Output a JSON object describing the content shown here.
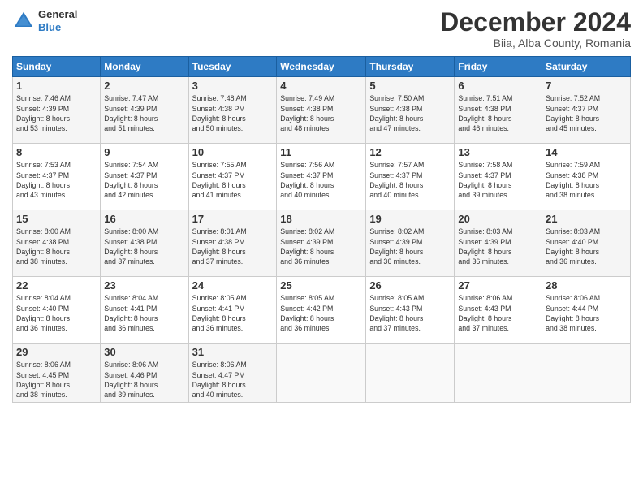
{
  "header": {
    "logo_general": "General",
    "logo_blue": "Blue",
    "title": "December 2024",
    "location": "Biia, Alba County, Romania"
  },
  "weekdays": [
    "Sunday",
    "Monday",
    "Tuesday",
    "Wednesday",
    "Thursday",
    "Friday",
    "Saturday"
  ],
  "weeks": [
    [
      {
        "day": "1",
        "info": "Sunrise: 7:46 AM\nSunset: 4:39 PM\nDaylight: 8 hours\nand 53 minutes."
      },
      {
        "day": "2",
        "info": "Sunrise: 7:47 AM\nSunset: 4:39 PM\nDaylight: 8 hours\nand 51 minutes."
      },
      {
        "day": "3",
        "info": "Sunrise: 7:48 AM\nSunset: 4:38 PM\nDaylight: 8 hours\nand 50 minutes."
      },
      {
        "day": "4",
        "info": "Sunrise: 7:49 AM\nSunset: 4:38 PM\nDaylight: 8 hours\nand 48 minutes."
      },
      {
        "day": "5",
        "info": "Sunrise: 7:50 AM\nSunset: 4:38 PM\nDaylight: 8 hours\nand 47 minutes."
      },
      {
        "day": "6",
        "info": "Sunrise: 7:51 AM\nSunset: 4:38 PM\nDaylight: 8 hours\nand 46 minutes."
      },
      {
        "day": "7",
        "info": "Sunrise: 7:52 AM\nSunset: 4:37 PM\nDaylight: 8 hours\nand 45 minutes."
      }
    ],
    [
      {
        "day": "8",
        "info": "Sunrise: 7:53 AM\nSunset: 4:37 PM\nDaylight: 8 hours\nand 43 minutes."
      },
      {
        "day": "9",
        "info": "Sunrise: 7:54 AM\nSunset: 4:37 PM\nDaylight: 8 hours\nand 42 minutes."
      },
      {
        "day": "10",
        "info": "Sunrise: 7:55 AM\nSunset: 4:37 PM\nDaylight: 8 hours\nand 41 minutes."
      },
      {
        "day": "11",
        "info": "Sunrise: 7:56 AM\nSunset: 4:37 PM\nDaylight: 8 hours\nand 40 minutes."
      },
      {
        "day": "12",
        "info": "Sunrise: 7:57 AM\nSunset: 4:37 PM\nDaylight: 8 hours\nand 40 minutes."
      },
      {
        "day": "13",
        "info": "Sunrise: 7:58 AM\nSunset: 4:37 PM\nDaylight: 8 hours\nand 39 minutes."
      },
      {
        "day": "14",
        "info": "Sunrise: 7:59 AM\nSunset: 4:38 PM\nDaylight: 8 hours\nand 38 minutes."
      }
    ],
    [
      {
        "day": "15",
        "info": "Sunrise: 8:00 AM\nSunset: 4:38 PM\nDaylight: 8 hours\nand 38 minutes."
      },
      {
        "day": "16",
        "info": "Sunrise: 8:00 AM\nSunset: 4:38 PM\nDaylight: 8 hours\nand 37 minutes."
      },
      {
        "day": "17",
        "info": "Sunrise: 8:01 AM\nSunset: 4:38 PM\nDaylight: 8 hours\nand 37 minutes."
      },
      {
        "day": "18",
        "info": "Sunrise: 8:02 AM\nSunset: 4:39 PM\nDaylight: 8 hours\nand 36 minutes."
      },
      {
        "day": "19",
        "info": "Sunrise: 8:02 AM\nSunset: 4:39 PM\nDaylight: 8 hours\nand 36 minutes."
      },
      {
        "day": "20",
        "info": "Sunrise: 8:03 AM\nSunset: 4:39 PM\nDaylight: 8 hours\nand 36 minutes."
      },
      {
        "day": "21",
        "info": "Sunrise: 8:03 AM\nSunset: 4:40 PM\nDaylight: 8 hours\nand 36 minutes."
      }
    ],
    [
      {
        "day": "22",
        "info": "Sunrise: 8:04 AM\nSunset: 4:40 PM\nDaylight: 8 hours\nand 36 minutes."
      },
      {
        "day": "23",
        "info": "Sunrise: 8:04 AM\nSunset: 4:41 PM\nDaylight: 8 hours\nand 36 minutes."
      },
      {
        "day": "24",
        "info": "Sunrise: 8:05 AM\nSunset: 4:41 PM\nDaylight: 8 hours\nand 36 minutes."
      },
      {
        "day": "25",
        "info": "Sunrise: 8:05 AM\nSunset: 4:42 PM\nDaylight: 8 hours\nand 36 minutes."
      },
      {
        "day": "26",
        "info": "Sunrise: 8:05 AM\nSunset: 4:43 PM\nDaylight: 8 hours\nand 37 minutes."
      },
      {
        "day": "27",
        "info": "Sunrise: 8:06 AM\nSunset: 4:43 PM\nDaylight: 8 hours\nand 37 minutes."
      },
      {
        "day": "28",
        "info": "Sunrise: 8:06 AM\nSunset: 4:44 PM\nDaylight: 8 hours\nand 38 minutes."
      }
    ],
    [
      {
        "day": "29",
        "info": "Sunrise: 8:06 AM\nSunset: 4:45 PM\nDaylight: 8 hours\nand 38 minutes."
      },
      {
        "day": "30",
        "info": "Sunrise: 8:06 AM\nSunset: 4:46 PM\nDaylight: 8 hours\nand 39 minutes."
      },
      {
        "day": "31",
        "info": "Sunrise: 8:06 AM\nSunset: 4:47 PM\nDaylight: 8 hours\nand 40 minutes."
      },
      {
        "day": "",
        "info": ""
      },
      {
        "day": "",
        "info": ""
      },
      {
        "day": "",
        "info": ""
      },
      {
        "day": "",
        "info": ""
      }
    ]
  ]
}
